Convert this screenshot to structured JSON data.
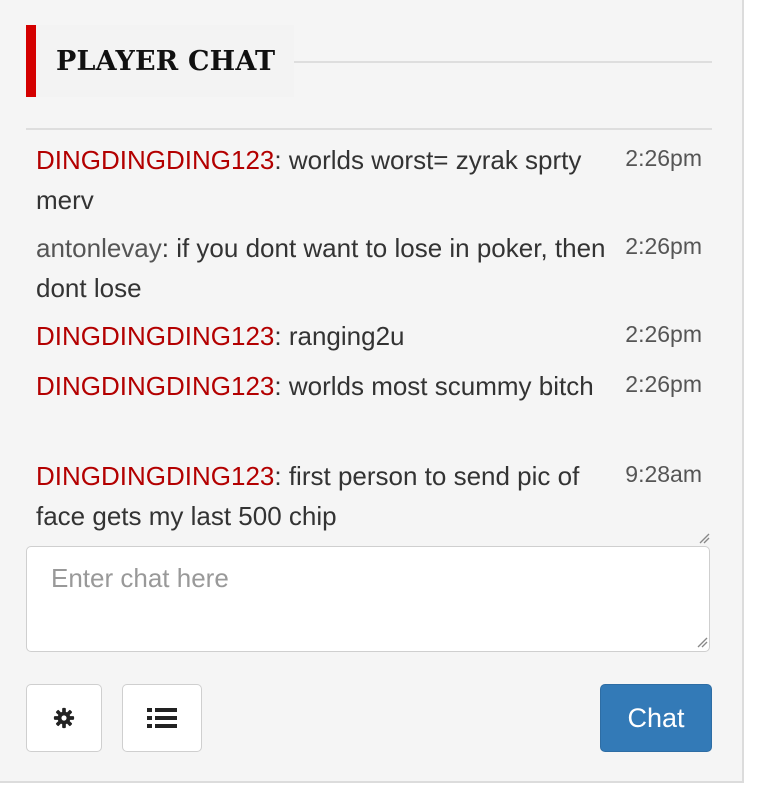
{
  "header": {
    "title": "PLAYER CHAT"
  },
  "messages": [
    {
      "user": "DINGDINGDING123",
      "user_color": "#b30000",
      "text": ": worlds worst= zyrak sprty merv",
      "time": "2:26pm"
    },
    {
      "user": "antonlevay",
      "user_color": "#555555",
      "text": ": if you dont want to lose in poker, then dont lose",
      "time": "2:26pm"
    },
    {
      "user": "DINGDINGDING123",
      "user_color": "#b30000",
      "text": ": ranging2u",
      "time": "2:26pm"
    },
    {
      "user": "DINGDINGDING123",
      "user_color": "#b30000",
      "text": ": worlds most scummy bitch",
      "time": "2:26pm"
    },
    {
      "user": "DINGDINGDING123",
      "user_color": "#b30000",
      "text": ": first person to send pic of face gets my last 500 chip",
      "time": "9:28am"
    }
  ],
  "input": {
    "placeholder": "Enter chat here",
    "value": ""
  },
  "buttons": {
    "settings_icon": "gear-icon",
    "list_icon": "list-icon",
    "chat_label": "Chat"
  },
  "colors": {
    "accent_red": "#d40000",
    "username_red": "#b30000",
    "primary_blue": "#337ab7"
  }
}
